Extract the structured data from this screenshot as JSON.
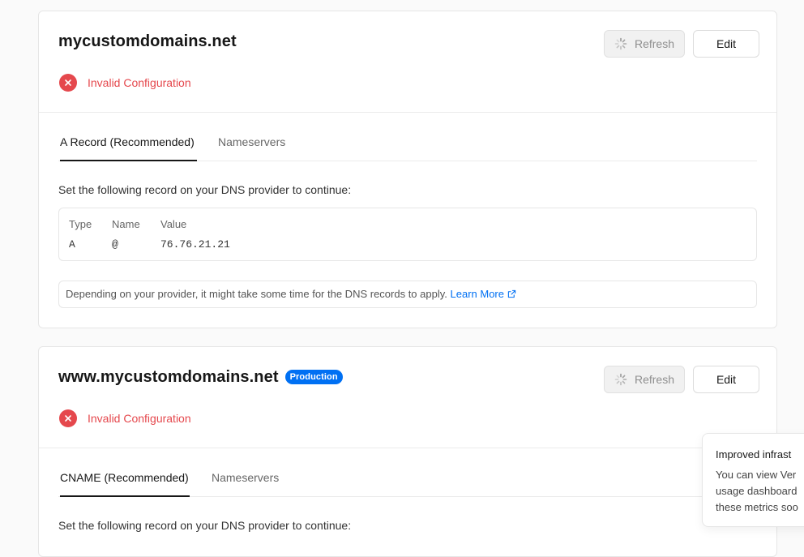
{
  "domains": [
    {
      "name": "mycustomdomains.net",
      "refresh_label": "Refresh",
      "edit_label": "Edit",
      "status": "Invalid Configuration",
      "tabs": [
        "A Record (Recommended)",
        "Nameservers"
      ],
      "instruction": "Set the following record on your DNS provider to continue:",
      "record": {
        "headers": [
          "Type",
          "Name",
          "Value"
        ],
        "values": [
          "A",
          "@",
          "76.76.21.21"
        ]
      },
      "note": "Depending on your provider, it might take some time for the DNS records to apply.",
      "learn_more": "Learn More"
    },
    {
      "name": "www.mycustomdomains.net",
      "badge": "Production",
      "refresh_label": "Refresh",
      "edit_label": "Edit",
      "status": "Invalid Configuration",
      "tabs": [
        "CNAME (Recommended)",
        "Nameservers"
      ],
      "instruction": "Set the following record on your DNS provider to continue:"
    }
  ],
  "toast": {
    "title": "Improved infrast",
    "body_lines": [
      "You can view Ver",
      "usage dashboard",
      "these metrics soo"
    ]
  },
  "colors": {
    "error": "#e5484d",
    "link": "#0070f3",
    "badge": "#0070f3"
  },
  "icons": {
    "spinner": "spinner-icon",
    "error": "error-x-icon",
    "external": "external-link-icon"
  }
}
